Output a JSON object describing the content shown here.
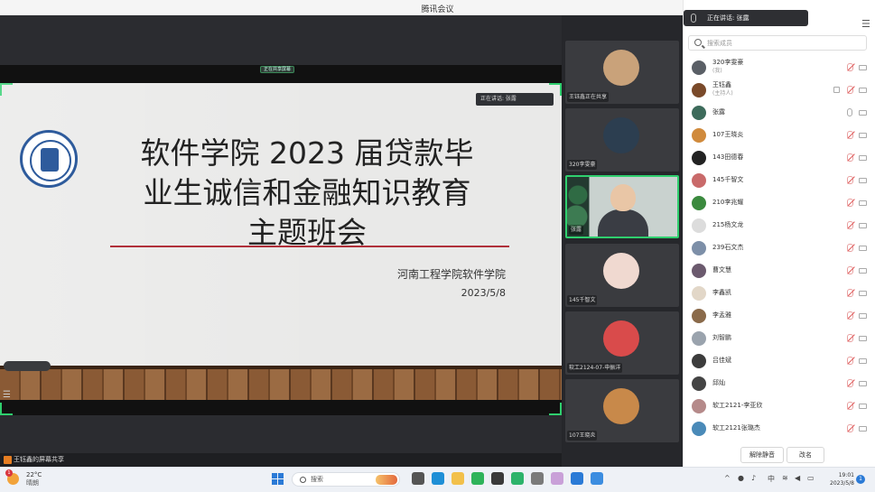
{
  "window": {
    "title": "腾讯会议",
    "controls": {
      "minimize": "—",
      "restore": "❐",
      "close": "✕"
    }
  },
  "share": {
    "status_pill": "正在共享屏幕",
    "speaking_tag": "正在讲话: 张露",
    "presenter_label": "王钰鑫的屏幕共享"
  },
  "slide": {
    "title_line1": "软件学院 2023 届贷款毕",
    "title_line2": "业生诚信和金融知识教育",
    "title_line3": "主题班会",
    "school": "河南工程学院软件学院",
    "date": "2023/5/8"
  },
  "tiles": [
    {
      "label": "王钰鑫正在共享",
      "avatar_color": "#c9a27a"
    },
    {
      "label": "320李雯豪",
      "avatar_color": "#2c3e50"
    },
    {
      "label": "张露",
      "avatar_color": "#e9c6a6"
    },
    {
      "label": "145千智文",
      "avatar_color": "#f0d9d0"
    },
    {
      "label": "软工2124-07-申振洋",
      "avatar_color": "#d94b4b"
    },
    {
      "label": "107王晓炎",
      "avatar_color": "#c8894a"
    }
  ],
  "panel": {
    "speaking_now": "正在讲话: 张露",
    "search_placeholder": "搜索成员",
    "participants": [
      {
        "name": "320李雯豪",
        "role": "(我)",
        "color": "#5a5f66"
      },
      {
        "name": "王钰鑫",
        "role": "(主持人)",
        "color": "#7a4a2a"
      },
      {
        "name": "张露",
        "role": "",
        "color": "#3d6b5b"
      },
      {
        "name": "107王晓炎",
        "role": "",
        "color": "#d08a3c"
      },
      {
        "name": "143田德春",
        "role": "",
        "color": "#222"
      },
      {
        "name": "145千智文",
        "role": "",
        "color": "#c96a6a"
      },
      {
        "name": "210李兆耀",
        "role": "",
        "color": "#3b8a3e"
      },
      {
        "name": "215杨文龙",
        "role": "",
        "color": "#dcdcdc"
      },
      {
        "name": "239石文杰",
        "role": "",
        "color": "#7d8fa8"
      },
      {
        "name": "曹文慧",
        "role": "",
        "color": "#6b5a6e"
      },
      {
        "name": "李鑫凯",
        "role": "",
        "color": "#e2d7c8"
      },
      {
        "name": "李孟雅",
        "role": "",
        "color": "#8a6a4a"
      },
      {
        "name": "刘智鹏",
        "role": "",
        "color": "#9aa3ad"
      },
      {
        "name": "吕佳斌",
        "role": "",
        "color": "#3c3c3c"
      },
      {
        "name": "邱灿",
        "role": "",
        "color": "#444"
      },
      {
        "name": "软工2121-李亚欣",
        "role": "",
        "color": "#b58a8a"
      },
      {
        "name": "软工2121张璐杰",
        "role": "",
        "color": "#4a8ab8"
      }
    ],
    "mute_all_button": "解除静音",
    "rename_button": "改名"
  },
  "taskbar": {
    "temperature": "22°C",
    "weather": "晴朗",
    "weather_badge": "1",
    "search_label": "搜索",
    "ime": "中",
    "time": "19:01",
    "date": "2023/5/8",
    "notifications": "1"
  }
}
